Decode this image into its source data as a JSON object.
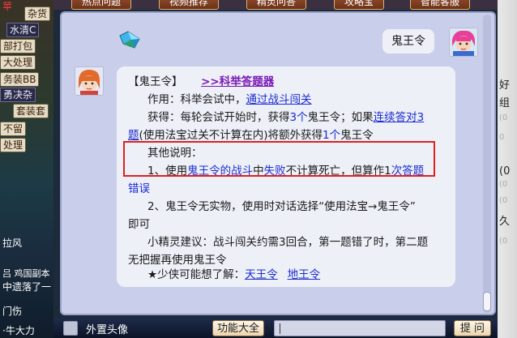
{
  "top_tabs": [
    "热点问题",
    "视频推荐",
    "精灵问答",
    "攻略宝",
    "智能客服"
  ],
  "game_left": [
    "苹",
    "杂货",
    "水清C",
    "部打包",
    "大处理",
    "务装BB",
    "勇决杂",
    "套装套",
    "不留",
    "处理",
    "拉风",
    "吕 鸡国副本",
    "中遗落了一",
    "门伤",
    "·牛大力"
  ],
  "game_right": [
    "好",
    "组",
    "(0",
    "0",
    "(0",
    "(0",
    "(0",
    "(0",
    "久",
    "人",
    "(0"
  ],
  "chat": {
    "user_message": "鬼王令",
    "bot_reply": {
      "heading": "【鬼王令】",
      "link_exam": ">>科举答题器",
      "effect_label": "作用：科举会试中，",
      "effect_link": "通过战斗闯关",
      "obtain_1": "获得：每轮会试开始时，获得",
      "obtain_count": "3个",
      "obtain_2": "鬼王令；如果",
      "obtain_correct": "连续答对3",
      "obtain_correct_cont": "题",
      "obtain_3": "(使用法宝过关不计算在内)将额外获得",
      "obtain_bonus": "1个",
      "obtain_4": "鬼王令",
      "other_label": "其他说明：",
      "note1_a": "1、使用",
      "note1_item": "鬼王令的",
      "note1_b": "战斗",
      "note1_c": "中",
      "note1_fail": "失败",
      "note1_d": "不计算死亡，但算作1",
      "note1_wrong": "次答题",
      "note1_wrong2": "错误",
      "note2": "2、鬼王令无实物，使用时对话选择“使用法宝→鬼王令”",
      "note2_cont": "即可",
      "tip_a": "小精灵建议：战斗闯关约需3回合，第一题错了时，第二题",
      "tip_b": "无把握再使用鬼王令",
      "more_label": "★少侠可能想了解：",
      "more_link1": "天王令",
      "more_link2": "地王令"
    }
  },
  "bottom": {
    "checkbox_label": "外置头像",
    "function_button": "功能大全",
    "input_value": "",
    "submit_button": "提 问"
  }
}
